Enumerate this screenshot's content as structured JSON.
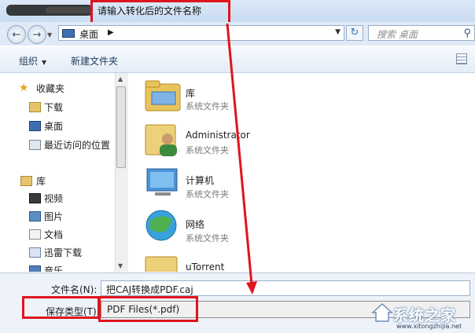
{
  "window": {
    "title": "请输入转化后的文件名称"
  },
  "nav": {
    "back": "←",
    "forward": "→",
    "dropdown": "▼",
    "refresh": "↻"
  },
  "address": {
    "location": "桌面",
    "separator": "▶",
    "dropdown": "▼"
  },
  "search": {
    "placeholder": "搜索 桌面",
    "icon": "search-icon"
  },
  "toolbar": {
    "organize": "组织",
    "organize_caret": "▼",
    "new_folder": "新建文件夹",
    "view_icon": "view-options-icon"
  },
  "sidebar": {
    "favorites": {
      "label": "收藏夹",
      "icon": "star-icon"
    },
    "favorite_items": [
      {
        "label": "下载",
        "icon": "download-folder-icon"
      },
      {
        "label": "桌面",
        "icon": "desktop-icon"
      },
      {
        "label": "最近访问的位置",
        "icon": "recent-places-icon"
      }
    ],
    "library": {
      "label": "库",
      "icon": "library-icon"
    },
    "library_items": [
      {
        "label": "视频",
        "icon": "video-icon"
      },
      {
        "label": "图片",
        "icon": "picture-icon"
      },
      {
        "label": "文档",
        "icon": "document-icon"
      },
      {
        "label": "迅雷下载",
        "icon": "thunder-download-icon"
      },
      {
        "label": "音乐",
        "icon": "music-icon"
      }
    ]
  },
  "files": [
    {
      "name": "库",
      "type": "系统文件夹",
      "icon": "library-folder-icon"
    },
    {
      "name": "Administrator",
      "type": "系统文件夹",
      "icon": "user-folder-icon"
    },
    {
      "name": "计算机",
      "type": "系统文件夹",
      "icon": "computer-icon"
    },
    {
      "name": "网络",
      "type": "系统文件夹",
      "icon": "network-icon"
    },
    {
      "name": "uTorrent",
      "type": "",
      "icon": "folder-icon"
    }
  ],
  "form": {
    "filename_label": "文件名(N):",
    "filename_value": "把CAJ转换成PDF.caj",
    "filetype_label": "保存类型(T):",
    "filetype_value": "PDF Files(*.pdf)"
  },
  "watermark": {
    "text": "系统之家",
    "url": "www.xitongzhijia.net"
  },
  "colors": {
    "highlight": "#e0141e",
    "toolbar_text": "#1e3a5f"
  }
}
